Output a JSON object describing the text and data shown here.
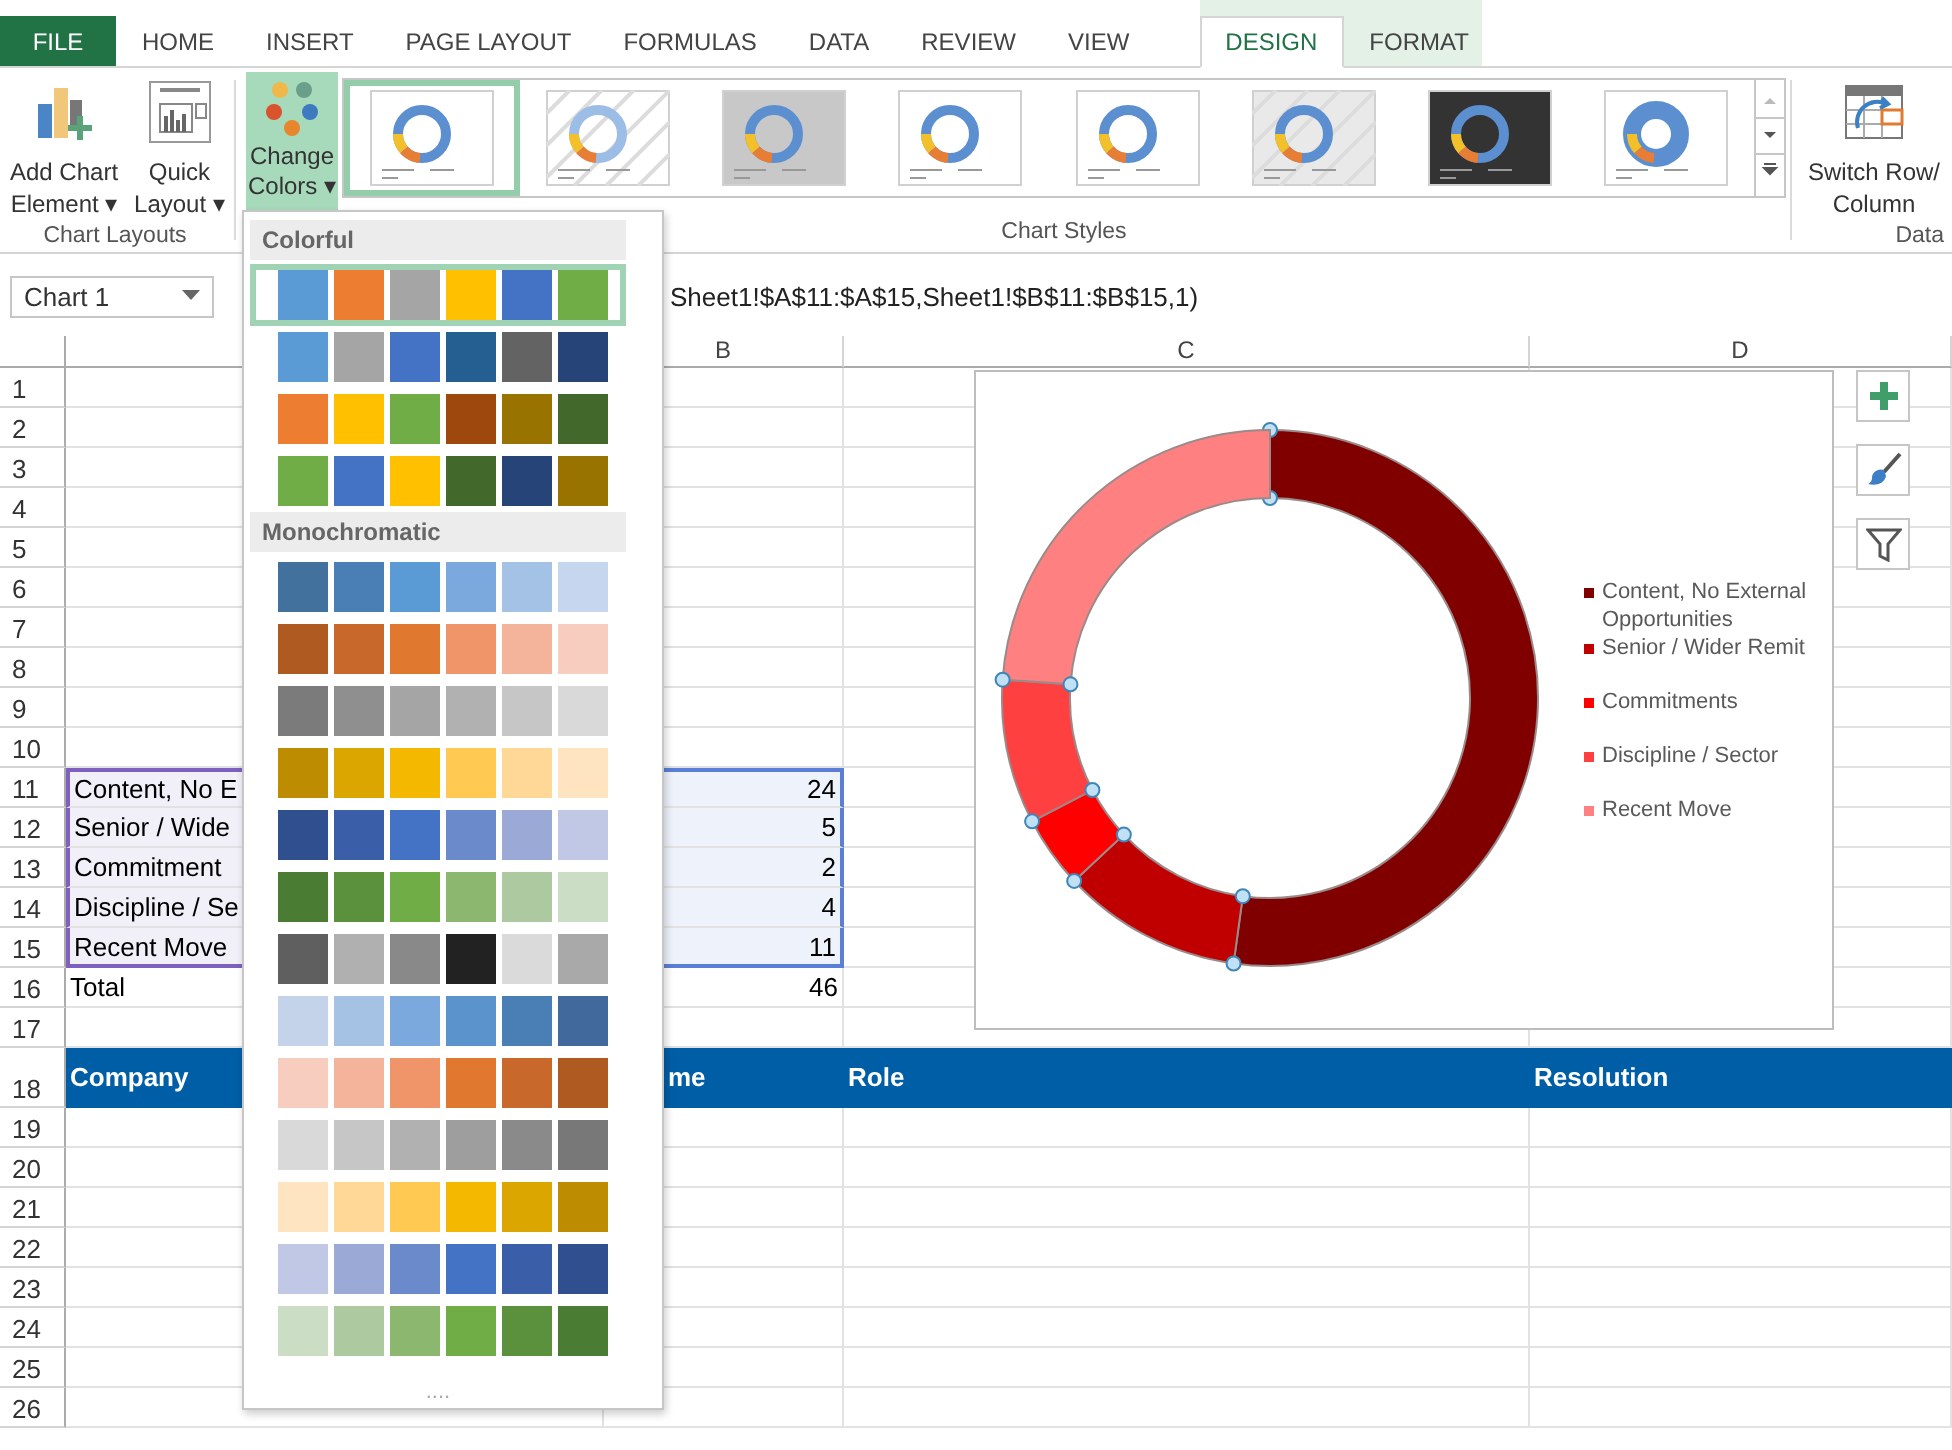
{
  "tabs": [
    {
      "label": "FILE",
      "kind": "file",
      "selected": false
    },
    {
      "label": "HOME",
      "kind": "plain",
      "selected": false
    },
    {
      "label": "INSERT",
      "kind": "plain",
      "selected": false
    },
    {
      "label": "PAGE LAYOUT",
      "kind": "plain",
      "selected": false
    },
    {
      "label": "FORMULAS",
      "kind": "plain",
      "selected": false
    },
    {
      "label": "DATA",
      "kind": "plain",
      "selected": false
    },
    {
      "label": "REVIEW",
      "kind": "plain",
      "selected": false
    },
    {
      "label": "VIEW",
      "kind": "plain",
      "selected": false
    },
    {
      "label": "DESIGN",
      "kind": "contextual",
      "selected": true
    },
    {
      "label": "FORMAT",
      "kind": "contextual",
      "selected": false
    }
  ],
  "ribbon": {
    "add_chart_element": [
      "Add Chart",
      "Element ▾"
    ],
    "quick_layout": [
      "Quick",
      "Layout ▾"
    ],
    "chart_layouts_label": "Chart Layouts",
    "change_colors": {
      "lines": [
        "Change",
        "Colors ▾"
      ],
      "on": true
    },
    "chart_styles": [
      {
        "kind": "plain",
        "selected": true
      },
      {
        "kind": "hatched",
        "selected": false
      },
      {
        "kind": "gray",
        "selected": false
      },
      {
        "kind": "light",
        "selected": false
      },
      {
        "kind": "plain",
        "selected": false
      },
      {
        "kind": "striped",
        "selected": false
      },
      {
        "kind": "dark",
        "selected": false
      },
      {
        "kind": "bold",
        "selected": false
      }
    ],
    "chart_styles_label": "Chart Styles",
    "switch_row_column": [
      "Switch Row/",
      "Column"
    ],
    "data_label": "Data"
  },
  "name_box": "Chart 1",
  "formula": "Sheet1!$A$11:$A$15,Sheet1!$B$11:$B$15,1)",
  "column_headers": [
    "B",
    "C",
    "D"
  ],
  "rows": [
    {
      "n": "1",
      "kind": "blank",
      "highlighted": false
    },
    {
      "n": "2",
      "kind": "blank",
      "highlighted": false
    },
    {
      "n": "3",
      "kind": "blank",
      "highlighted": false
    },
    {
      "n": "4",
      "kind": "blank",
      "highlighted": false
    },
    {
      "n": "5",
      "kind": "blank",
      "highlighted": false
    },
    {
      "n": "6",
      "kind": "blank",
      "highlighted": false
    },
    {
      "n": "7",
      "kind": "blank",
      "highlighted": false
    },
    {
      "n": "8",
      "kind": "blank",
      "highlighted": false
    },
    {
      "n": "9",
      "kind": "blank",
      "highlighted": false
    },
    {
      "n": "10",
      "kind": "blank",
      "highlighted": false
    },
    {
      "n": "11",
      "kind": "data",
      "a": "Content, No E",
      "b": "24",
      "highlighted": true
    },
    {
      "n": "12",
      "kind": "data",
      "a": "Senior / Wide",
      "b": "5",
      "highlighted": true
    },
    {
      "n": "13",
      "kind": "data",
      "a": "Commitment",
      "b": "2",
      "highlighted": true
    },
    {
      "n": "14",
      "kind": "data",
      "a": "Discipline / Se",
      "b": "4",
      "highlighted": true
    },
    {
      "n": "15",
      "kind": "data",
      "a": "Recent Move",
      "b": "11",
      "highlighted": true
    },
    {
      "n": "16",
      "kind": "data",
      "a": "Total",
      "b": "46",
      "highlighted": false
    },
    {
      "n": "17",
      "kind": "blank",
      "highlighted": false
    },
    {
      "n": "18",
      "kind": "header",
      "cells": [
        "Company",
        "me",
        "Role",
        "Resolution"
      ],
      "highlighted": false
    },
    {
      "n": "19",
      "kind": "blank",
      "highlighted": false
    },
    {
      "n": "20",
      "kind": "blank",
      "highlighted": false
    },
    {
      "n": "21",
      "kind": "blank",
      "highlighted": false
    },
    {
      "n": "22",
      "kind": "blank",
      "highlighted": false
    },
    {
      "n": "23",
      "kind": "blank",
      "highlighted": false
    },
    {
      "n": "24",
      "kind": "blank",
      "highlighted": false
    },
    {
      "n": "25",
      "kind": "blank",
      "highlighted": false
    },
    {
      "n": "26",
      "kind": "blank",
      "highlighted": false
    }
  ],
  "chart": {
    "chart_data": {
      "type": "donut",
      "categories": [
        "Content, No External Opportunities",
        "Senior / Wider Remit",
        "Commitments",
        "Discipline / Sector",
        "Recent Move"
      ],
      "values": [
        52.17,
        10.87,
        4.35,
        8.7,
        23.91
      ],
      "colors": [
        "#800000",
        "#c00000",
        "#ff0000",
        "#ff4040",
        "#ff8080"
      ]
    }
  },
  "color_menu": {
    "sections": [
      {
        "title": "Colorful",
        "schemes": [
          {
            "selected": true,
            "swatches": [
              {
                "color": "#5b9bd5"
              },
              {
                "color": "#ed7d31"
              },
              {
                "color": "#a5a5a5"
              },
              {
                "color": "#ffc000"
              },
              {
                "color": "#4472c4"
              },
              {
                "color": "#70ad47"
              }
            ]
          },
          {
            "selected": false,
            "swatches": [
              {
                "color": "#5b9bd5"
              },
              {
                "color": "#a5a5a5"
              },
              {
                "color": "#4472c4"
              },
              {
                "color": "#255e91"
              },
              {
                "color": "#636363"
              },
              {
                "color": "#264478"
              }
            ]
          },
          {
            "selected": false,
            "swatches": [
              {
                "color": "#ed7d31"
              },
              {
                "color": "#ffc000"
              },
              {
                "color": "#70ad47"
              },
              {
                "color": "#9e480e"
              },
              {
                "color": "#997300"
              },
              {
                "color": "#43682b"
              }
            ]
          },
          {
            "selected": false,
            "swatches": [
              {
                "color": "#70ad47"
              },
              {
                "color": "#4472c4"
              },
              {
                "color": "#ffc000"
              },
              {
                "color": "#43682b"
              },
              {
                "color": "#264478"
              },
              {
                "color": "#997300"
              }
            ]
          }
        ]
      },
      {
        "title": "Monochromatic",
        "schemes": [
          {
            "selected": false,
            "swatches": [
              {
                "color": "#41719c"
              },
              {
                "color": "#4a7fb5"
              },
              {
                "color": "#5b9bd5"
              },
              {
                "color": "#7ca9dd"
              },
              {
                "color": "#a3c2e6"
              },
              {
                "color": "#c5d6ee"
              }
            ]
          },
          {
            "selected": false,
            "swatches": [
              {
                "color": "#ae5a21"
              },
              {
                "color": "#c9682b"
              },
              {
                "color": "#e07830"
              },
              {
                "color": "#f0956a"
              },
              {
                "color": "#f3b49b"
              },
              {
                "color": "#f6cdbf"
              }
            ]
          },
          {
            "selected": false,
            "swatches": [
              {
                "color": "#7b7b7b"
              },
              {
                "color": "#8f8f8f"
              },
              {
                "color": "#a5a5a5"
              },
              {
                "color": "#b1b1b1"
              },
              {
                "color": "#c6c6c6"
              },
              {
                "color": "#d9d9d9"
              }
            ]
          },
          {
            "selected": false,
            "swatches": [
              {
                "color": "#bd8c00"
              },
              {
                "color": "#dca600"
              },
              {
                "color": "#f5b800"
              },
              {
                "color": "#ffc952"
              },
              {
                "color": "#ffd797"
              },
              {
                "color": "#ffe4c2"
              }
            ]
          },
          {
            "selected": false,
            "swatches": [
              {
                "color": "#2f4f8f"
              },
              {
                "color": "#3a5ea8"
              },
              {
                "color": "#4472c4"
              },
              {
                "color": "#6b8acb"
              },
              {
                "color": "#9aa9d6"
              },
              {
                "color": "#c0c8e5"
              }
            ]
          },
          {
            "selected": false,
            "swatches": [
              {
                "color": "#4a7c33"
              },
              {
                "color": "#5b913c"
              },
              {
                "color": "#70ad47"
              },
              {
                "color": "#8bb76f"
              },
              {
                "color": "#adc9a0"
              },
              {
                "color": "#cbddc4"
              }
            ]
          },
          {
            "selected": false,
            "swatches": [
              {
                "color": "#5f5f5f"
              },
              {
                "color": "#b0b0b0"
              },
              {
                "color": "#898989"
              },
              {
                "color": "#222222"
              },
              {
                "color": "#dadada"
              },
              {
                "color": "#a9a9a9"
              }
            ]
          },
          {
            "selected": false,
            "swatches": [
              {
                "color": "#c5d3ea"
              },
              {
                "color": "#a5c1e3"
              },
              {
                "color": "#7ca9dd"
              },
              {
                "color": "#5b93cc"
              },
              {
                "color": "#4a7fb5"
              },
              {
                "color": "#41699c"
              }
            ]
          },
          {
            "selected": false,
            "swatches": [
              {
                "color": "#f6cdbf"
              },
              {
                "color": "#f3b49b"
              },
              {
                "color": "#f0956a"
              },
              {
                "color": "#e07830"
              },
              {
                "color": "#c9682b"
              },
              {
                "color": "#ae5a21"
              }
            ]
          },
          {
            "selected": false,
            "swatches": [
              {
                "color": "#d9d9d9"
              },
              {
                "color": "#c6c6c6"
              },
              {
                "color": "#b1b1b1"
              },
              {
                "color": "#9e9e9e"
              },
              {
                "color": "#8a8a8a"
              },
              {
                "color": "#787878"
              }
            ]
          },
          {
            "selected": false,
            "swatches": [
              {
                "color": "#ffe4c2"
              },
              {
                "color": "#ffd797"
              },
              {
                "color": "#ffc952"
              },
              {
                "color": "#f5b800"
              },
              {
                "color": "#dca600"
              },
              {
                "color": "#bd8c00"
              }
            ]
          },
          {
            "selected": false,
            "swatches": [
              {
                "color": "#c0c8e5"
              },
              {
                "color": "#9aa9d6"
              },
              {
                "color": "#6b8acb"
              },
              {
                "color": "#4472c4"
              },
              {
                "color": "#3a5ea8"
              },
              {
                "color": "#2f4f8f"
              }
            ]
          },
          {
            "selected": false,
            "swatches": [
              {
                "color": "#cbddc4"
              },
              {
                "color": "#adc9a0"
              },
              {
                "color": "#8bb76f"
              },
              {
                "color": "#70ad47"
              },
              {
                "color": "#5b913c"
              },
              {
                "color": "#4a7c33"
              }
            ]
          }
        ]
      }
    ],
    "more": "...."
  }
}
